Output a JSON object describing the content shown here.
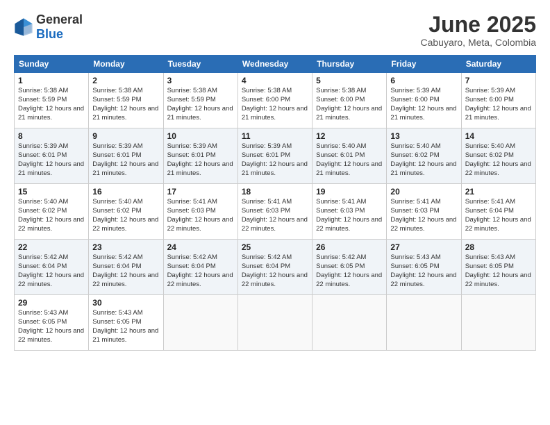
{
  "header": {
    "logo_general": "General",
    "logo_blue": "Blue",
    "title": "June 2025",
    "subtitle": "Cabuyaro, Meta, Colombia"
  },
  "weekdays": [
    "Sunday",
    "Monday",
    "Tuesday",
    "Wednesday",
    "Thursday",
    "Friday",
    "Saturday"
  ],
  "weeks": [
    [
      {
        "day": "1",
        "sunrise": "Sunrise: 5:38 AM",
        "sunset": "Sunset: 5:59 PM",
        "daylight": "Daylight: 12 hours and 21 minutes."
      },
      {
        "day": "2",
        "sunrise": "Sunrise: 5:38 AM",
        "sunset": "Sunset: 5:59 PM",
        "daylight": "Daylight: 12 hours and 21 minutes."
      },
      {
        "day": "3",
        "sunrise": "Sunrise: 5:38 AM",
        "sunset": "Sunset: 5:59 PM",
        "daylight": "Daylight: 12 hours and 21 minutes."
      },
      {
        "day": "4",
        "sunrise": "Sunrise: 5:38 AM",
        "sunset": "Sunset: 6:00 PM",
        "daylight": "Daylight: 12 hours and 21 minutes."
      },
      {
        "day": "5",
        "sunrise": "Sunrise: 5:38 AM",
        "sunset": "Sunset: 6:00 PM",
        "daylight": "Daylight: 12 hours and 21 minutes."
      },
      {
        "day": "6",
        "sunrise": "Sunrise: 5:39 AM",
        "sunset": "Sunset: 6:00 PM",
        "daylight": "Daylight: 12 hours and 21 minutes."
      },
      {
        "day": "7",
        "sunrise": "Sunrise: 5:39 AM",
        "sunset": "Sunset: 6:00 PM",
        "daylight": "Daylight: 12 hours and 21 minutes."
      }
    ],
    [
      {
        "day": "8",
        "sunrise": "Sunrise: 5:39 AM",
        "sunset": "Sunset: 6:01 PM",
        "daylight": "Daylight: 12 hours and 21 minutes."
      },
      {
        "day": "9",
        "sunrise": "Sunrise: 5:39 AM",
        "sunset": "Sunset: 6:01 PM",
        "daylight": "Daylight: 12 hours and 21 minutes."
      },
      {
        "day": "10",
        "sunrise": "Sunrise: 5:39 AM",
        "sunset": "Sunset: 6:01 PM",
        "daylight": "Daylight: 12 hours and 21 minutes."
      },
      {
        "day": "11",
        "sunrise": "Sunrise: 5:39 AM",
        "sunset": "Sunset: 6:01 PM",
        "daylight": "Daylight: 12 hours and 21 minutes."
      },
      {
        "day": "12",
        "sunrise": "Sunrise: 5:40 AM",
        "sunset": "Sunset: 6:01 PM",
        "daylight": "Daylight: 12 hours and 21 minutes."
      },
      {
        "day": "13",
        "sunrise": "Sunrise: 5:40 AM",
        "sunset": "Sunset: 6:02 PM",
        "daylight": "Daylight: 12 hours and 21 minutes."
      },
      {
        "day": "14",
        "sunrise": "Sunrise: 5:40 AM",
        "sunset": "Sunset: 6:02 PM",
        "daylight": "Daylight: 12 hours and 22 minutes."
      }
    ],
    [
      {
        "day": "15",
        "sunrise": "Sunrise: 5:40 AM",
        "sunset": "Sunset: 6:02 PM",
        "daylight": "Daylight: 12 hours and 22 minutes."
      },
      {
        "day": "16",
        "sunrise": "Sunrise: 5:40 AM",
        "sunset": "Sunset: 6:02 PM",
        "daylight": "Daylight: 12 hours and 22 minutes."
      },
      {
        "day": "17",
        "sunrise": "Sunrise: 5:41 AM",
        "sunset": "Sunset: 6:03 PM",
        "daylight": "Daylight: 12 hours and 22 minutes."
      },
      {
        "day": "18",
        "sunrise": "Sunrise: 5:41 AM",
        "sunset": "Sunset: 6:03 PM",
        "daylight": "Daylight: 12 hours and 22 minutes."
      },
      {
        "day": "19",
        "sunrise": "Sunrise: 5:41 AM",
        "sunset": "Sunset: 6:03 PM",
        "daylight": "Daylight: 12 hours and 22 minutes."
      },
      {
        "day": "20",
        "sunrise": "Sunrise: 5:41 AM",
        "sunset": "Sunset: 6:03 PM",
        "daylight": "Daylight: 12 hours and 22 minutes."
      },
      {
        "day": "21",
        "sunrise": "Sunrise: 5:41 AM",
        "sunset": "Sunset: 6:04 PM",
        "daylight": "Daylight: 12 hours and 22 minutes."
      }
    ],
    [
      {
        "day": "22",
        "sunrise": "Sunrise: 5:42 AM",
        "sunset": "Sunset: 6:04 PM",
        "daylight": "Daylight: 12 hours and 22 minutes."
      },
      {
        "day": "23",
        "sunrise": "Sunrise: 5:42 AM",
        "sunset": "Sunset: 6:04 PM",
        "daylight": "Daylight: 12 hours and 22 minutes."
      },
      {
        "day": "24",
        "sunrise": "Sunrise: 5:42 AM",
        "sunset": "Sunset: 6:04 PM",
        "daylight": "Daylight: 12 hours and 22 minutes."
      },
      {
        "day": "25",
        "sunrise": "Sunrise: 5:42 AM",
        "sunset": "Sunset: 6:04 PM",
        "daylight": "Daylight: 12 hours and 22 minutes."
      },
      {
        "day": "26",
        "sunrise": "Sunrise: 5:42 AM",
        "sunset": "Sunset: 6:05 PM",
        "daylight": "Daylight: 12 hours and 22 minutes."
      },
      {
        "day": "27",
        "sunrise": "Sunrise: 5:43 AM",
        "sunset": "Sunset: 6:05 PM",
        "daylight": "Daylight: 12 hours and 22 minutes."
      },
      {
        "day": "28",
        "sunrise": "Sunrise: 5:43 AM",
        "sunset": "Sunset: 6:05 PM",
        "daylight": "Daylight: 12 hours and 22 minutes."
      }
    ],
    [
      {
        "day": "29",
        "sunrise": "Sunrise: 5:43 AM",
        "sunset": "Sunset: 6:05 PM",
        "daylight": "Daylight: 12 hours and 22 minutes."
      },
      {
        "day": "30",
        "sunrise": "Sunrise: 5:43 AM",
        "sunset": "Sunset: 6:05 PM",
        "daylight": "Daylight: 12 hours and 21 minutes."
      },
      null,
      null,
      null,
      null,
      null
    ]
  ]
}
